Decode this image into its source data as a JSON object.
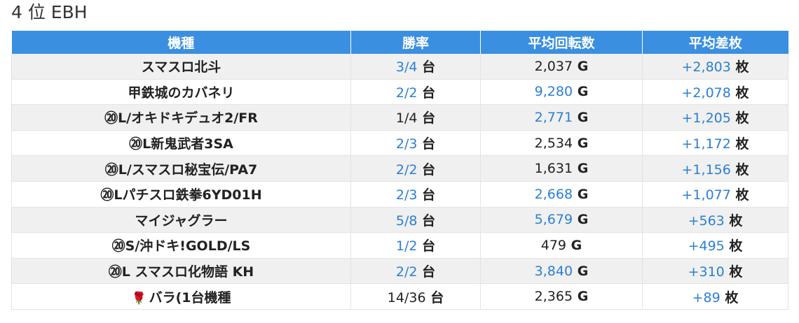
{
  "header": {
    "title": "4 位 EBH"
  },
  "table": {
    "columns": [
      "機種",
      "勝率",
      "平均回転数",
      "平均差枚"
    ],
    "win_unit": "台",
    "spin_unit": "G",
    "diff_unit": "枚",
    "rows": [
      {
        "machine": "スマスロ北斗",
        "win": "3/4",
        "win_hl": true,
        "spins": "2,037",
        "spins_hl": false,
        "diff": "+2,803",
        "diff_hl": true,
        "rose": false
      },
      {
        "machine": "甲鉄城のカバネリ",
        "win": "2/2",
        "win_hl": true,
        "spins": "9,280",
        "spins_hl": true,
        "diff": "+2,078",
        "diff_hl": true,
        "rose": false
      },
      {
        "machine": "⑳L/オキドキデュオ2/FR",
        "win": "1/4",
        "win_hl": false,
        "spins": "2,771",
        "spins_hl": true,
        "diff": "+1,205",
        "diff_hl": true,
        "rose": false
      },
      {
        "machine": "⑳L新鬼武者3SA",
        "win": "2/3",
        "win_hl": true,
        "spins": "2,534",
        "spins_hl": false,
        "diff": "+1,172",
        "diff_hl": true,
        "rose": false
      },
      {
        "machine": "⑳L/スマスロ秘宝伝/PA7",
        "win": "2/2",
        "win_hl": true,
        "spins": "1,631",
        "spins_hl": false,
        "diff": "+1,156",
        "diff_hl": true,
        "rose": false
      },
      {
        "machine": "⑳Lパチスロ鉄拳6YD01H",
        "win": "2/3",
        "win_hl": true,
        "spins": "2,668",
        "spins_hl": true,
        "diff": "+1,077",
        "diff_hl": true,
        "rose": false
      },
      {
        "machine": "マイジャグラー",
        "win": "5/8",
        "win_hl": true,
        "spins": "5,679",
        "spins_hl": true,
        "diff": "+563",
        "diff_hl": true,
        "rose": false
      },
      {
        "machine": "⑳S/沖ドキ!GOLD/LS",
        "win": "1/2",
        "win_hl": true,
        "spins": "479",
        "spins_hl": false,
        "diff": "+495",
        "diff_hl": true,
        "rose": false
      },
      {
        "machine": "⑳L スマスロ化物語 KH",
        "win": "2/2",
        "win_hl": true,
        "spins": "3,840",
        "spins_hl": true,
        "diff": "+310",
        "diff_hl": true,
        "rose": false
      },
      {
        "machine": "バラ(1台機種",
        "win": "14/36",
        "win_hl": false,
        "spins": "2,365",
        "spins_hl": false,
        "diff": "+89",
        "diff_hl": true,
        "rose": true
      }
    ]
  },
  "icons": {
    "rose": "rose-icon"
  },
  "colors": {
    "header_bg": "#3a8fe0",
    "highlight": "#2b7fd4",
    "stripe": "#f0f0f0"
  }
}
